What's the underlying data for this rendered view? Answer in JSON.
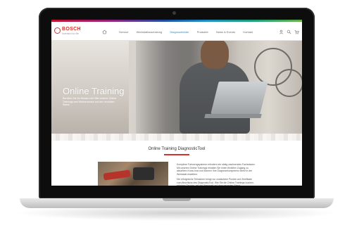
{
  "nav": {
    "brand": "BOSCH",
    "brand_tagline": "Invented for life",
    "items": [
      {
        "label": "Service",
        "active": false
      },
      {
        "label": "Werkstattausrüstung",
        "active": false
      },
      {
        "label": "Diagnosetester",
        "active": true
      },
      {
        "label": "Produkte",
        "active": false
      },
      {
        "label": "News & Events",
        "active": false
      },
      {
        "label": "Kontakt",
        "active": false
      }
    ],
    "icons": [
      "home-icon",
      "user-icon",
      "search-icon",
      "cart-icon"
    ]
  },
  "hero": {
    "title": "Online Training",
    "subtitle": "Bereiten Sie Ihr Wissen mit Hilfe unserer Online Trainings und Webseminare auf den neuesten Stand."
  },
  "section": {
    "title": "Online Training DiagnosticTool",
    "paragraphs": [
      "Komplexe Fahrzeugsysteme erfordern ein stetig wachsendes Fachwissen. Mit unseren Online Trainings erhalten Sie einen flexiblen Zugang zu aktuellem Know-how und können Ihre Diagnosekompetenz direkt in der Werkstatt erweitern.",
      "Die erfolgreiche Teilnahme bringt nur zusätzliche Punkte und Zertifikate zum Abschluss des DiagnosticTool. Wie Sie die Online-Trainings buchen, erfahren Sie hier, mit der Werkstatt auf dem neuesten Stand."
    ]
  },
  "colors": {
    "brand_red": "#d9322a",
    "active_nav": "#2a8fc8"
  }
}
